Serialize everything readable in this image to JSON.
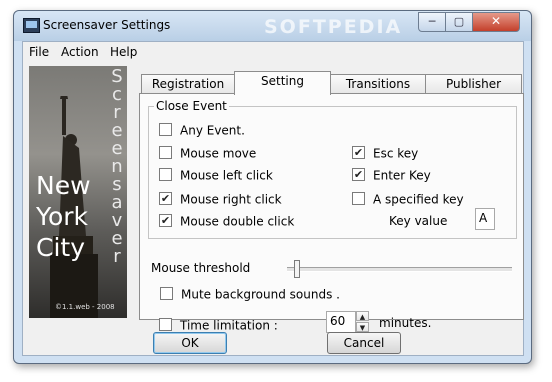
{
  "window": {
    "title": "Screensaver Settings",
    "watermark": "SOFTPEDIA",
    "controls": {
      "minimize": "─",
      "maximize": "▢",
      "close": "✕"
    }
  },
  "menu": {
    "items": [
      "File",
      "Action",
      "Help"
    ]
  },
  "side_image": {
    "vertical_text": [
      "S",
      "c",
      "r",
      "e",
      "e",
      "n",
      "s",
      "a",
      "v",
      "e",
      "r"
    ],
    "city_lines": [
      "New",
      "York",
      "City"
    ],
    "copyright": "©1.1.web - 2008"
  },
  "tabs": {
    "items": [
      {
        "label": "Registration",
        "active": false
      },
      {
        "label": "Setting",
        "active": true
      },
      {
        "label": "Transitions",
        "active": false
      },
      {
        "label": "Publisher",
        "active": false
      }
    ]
  },
  "close_event": {
    "title": "Close Event",
    "any_event": {
      "label": "Any Event.",
      "checked": false
    },
    "mouse_move": {
      "label": "Mouse move",
      "checked": false
    },
    "mouse_left_click": {
      "label": "Mouse left click",
      "checked": false
    },
    "mouse_right_click": {
      "label": "Mouse right click",
      "checked": true
    },
    "mouse_double_click": {
      "label": "Mouse double click",
      "checked": true
    },
    "esc_key": {
      "label": "Esc key",
      "checked": true
    },
    "enter_key": {
      "label": "Enter Key",
      "checked": true
    },
    "specified_key": {
      "label": "A specified key",
      "checked": false
    },
    "key_value_label": "Key value",
    "key_value": "A"
  },
  "mouse_threshold": {
    "label": "Mouse threshold",
    "level": 0.03
  },
  "mute_sounds": {
    "label": "Mute background sounds .",
    "checked": false
  },
  "time_limitation": {
    "label": "Time limitation :",
    "checked": false,
    "value": "60",
    "unit": "minutes."
  },
  "buttons": {
    "ok": "OK",
    "cancel": "Cancel"
  },
  "icons": {
    "checked": "✔",
    "spin_up": "▲",
    "spin_down": "▼"
  },
  "colors": {
    "frame": "#cfe0f2",
    "close_button": "#c4402b",
    "default_button_border": "#3c7fb1"
  }
}
